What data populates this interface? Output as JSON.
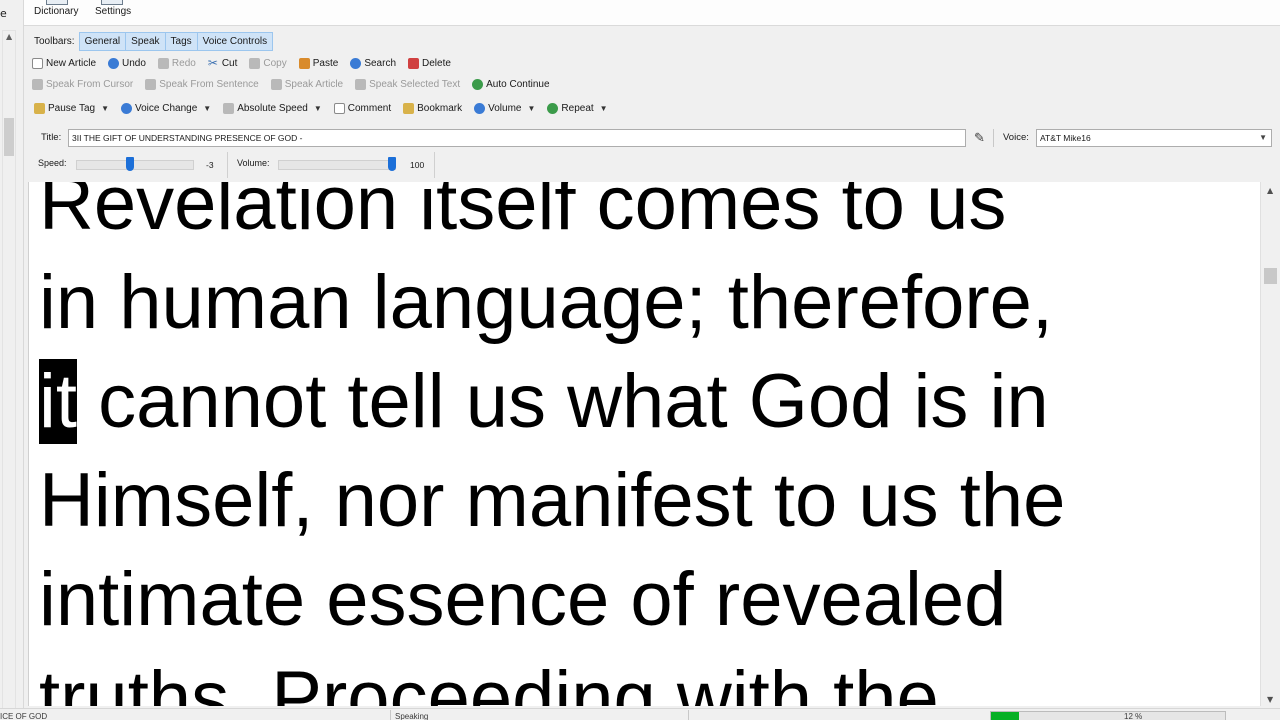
{
  "ribbon": {
    "dictionary_label": "Dictionary",
    "settings_label": "Settings"
  },
  "toolbars": {
    "label": "Toolbars:",
    "tabs": [
      "General",
      "Speak",
      "Tags",
      "Voice Controls"
    ]
  },
  "row1": {
    "new_article": "New Article",
    "undo": "Undo",
    "redo": "Redo",
    "cut": "Cut",
    "copy": "Copy",
    "paste": "Paste",
    "search": "Search",
    "delete": "Delete"
  },
  "row2": {
    "speak_from_cursor": "Speak From Cursor",
    "speak_from_sentence": "Speak From Sentence",
    "speak_article": "Speak Article",
    "speak_selected_text": "Speak Selected Text",
    "auto_continue": "Auto Continue"
  },
  "row3": {
    "pause_tag": "Pause Tag",
    "voice_change": "Voice Change",
    "absolute_speed": "Absolute Speed",
    "comment": "Comment",
    "bookmark": "Bookmark",
    "volume": "Volume",
    "repeat": "Repeat"
  },
  "title_field": {
    "label": "Title:",
    "value": "3II THE GIFT OF UNDERSTANDING PRESENCE OF GOD -"
  },
  "voice_field": {
    "label": "Voice:",
    "value": "AT&T Mike16"
  },
  "speed": {
    "label": "Speed:",
    "value": "-3",
    "level_fraction": 0.45
  },
  "volume": {
    "label": "Volume:",
    "value": "100",
    "level_fraction": 1.0
  },
  "reader": {
    "lines": [
      "Revelation itself comes to us",
      "in human language; therefore,",
      "cannot tell us what God is in",
      "Himself, nor manifest to us the",
      "intimate essence of revealed",
      "truths. Proceeding with the"
    ],
    "highlighted_word": "it"
  },
  "status": {
    "title_fragment": "ICE OF GOD",
    "state": "Speaking",
    "progress_percent": 12,
    "progress_label": "12 %"
  }
}
